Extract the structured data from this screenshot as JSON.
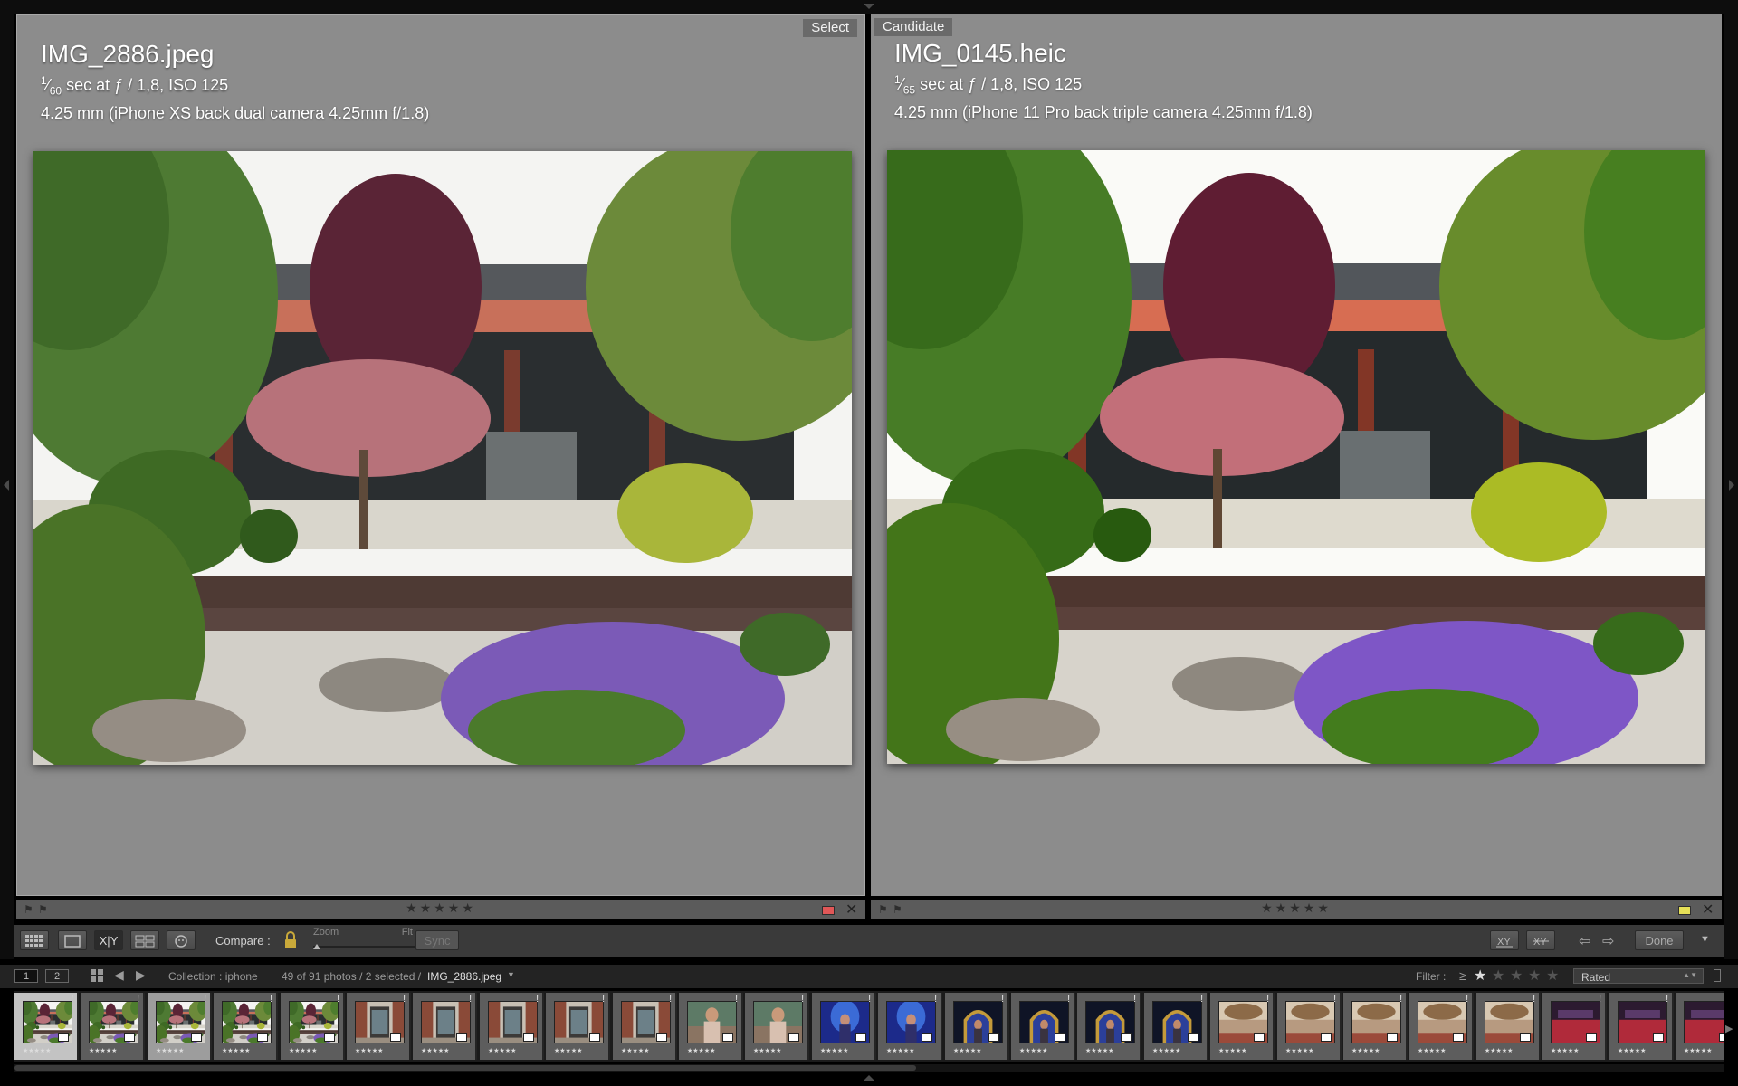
{
  "left_pane": {
    "tag": "Select",
    "filename": "IMG_2886.jpeg",
    "shutter_num": "1",
    "shutter_den": "60",
    "exposure_rest": " sec at ƒ / 1,8, ISO 125",
    "lens": "4.25 mm (iPhone XS back dual camera 4.25mm f/1.8)",
    "rating": "★★★★★",
    "label_color": "#e05757"
  },
  "right_pane": {
    "tag": "Candidate",
    "filename": "IMG_0145.heic",
    "shutter_num": "1",
    "shutter_den": "65",
    "exposure_rest": " sec at ƒ / 1,8, ISO 125",
    "lens": "4.25 mm (iPhone 11 Pro back triple camera 4.25mm f/1.8)",
    "rating": "★★★★★",
    "label_color": "#e6e057"
  },
  "toolbar": {
    "compare_label": "Compare :",
    "zoom_label": "Zoom",
    "fit_label": "Fit",
    "sync_label": "Sync",
    "xy_label": "X|Y",
    "done_label": "Done"
  },
  "filmbar": {
    "screen1": "1",
    "screen2": "2",
    "collection": "Collection : iphone",
    "count": "49 of 91 photos / 2 selected /",
    "current_file": "IMG_2886.jpeg",
    "filter_label": "Filter :",
    "filter_op": "≥",
    "filter_value": "Rated"
  },
  "filmstrip": {
    "cells": [
      {
        "scene": "garden",
        "stars": "★★★★★",
        "state": "active"
      },
      {
        "scene": "garden",
        "stars": "★★★★★",
        "state": "normal"
      },
      {
        "scene": "garden",
        "stars": "★★★★★",
        "state": "sel"
      },
      {
        "scene": "garden",
        "stars": "★★★★★",
        "state": "normal"
      },
      {
        "scene": "garden",
        "stars": "★★★★★",
        "state": "normal"
      },
      {
        "scene": "door",
        "stars": "★★★★★",
        "state": "normal"
      },
      {
        "scene": "door",
        "stars": "★★★★★",
        "state": "normal"
      },
      {
        "scene": "door",
        "stars": "★★★★★",
        "state": "normal"
      },
      {
        "scene": "door",
        "stars": "★★★★★",
        "state": "normal"
      },
      {
        "scene": "door",
        "stars": "★★★★★",
        "state": "normal"
      },
      {
        "scene": "person",
        "stars": "★★★★★",
        "state": "normal"
      },
      {
        "scene": "person",
        "stars": "★★★★★",
        "state": "normal"
      },
      {
        "scene": "blue",
        "stars": "★★★★★",
        "state": "normal"
      },
      {
        "scene": "blue",
        "stars": "★★★★★",
        "state": "normal"
      },
      {
        "scene": "arch",
        "stars": "★★★★★",
        "state": "normal"
      },
      {
        "scene": "arch",
        "stars": "★★★★★",
        "state": "normal"
      },
      {
        "scene": "arch",
        "stars": "★★★★★",
        "state": "normal"
      },
      {
        "scene": "arch",
        "stars": "★★★★★",
        "state": "normal"
      },
      {
        "scene": "hall",
        "stars": "★★★★★",
        "state": "normal"
      },
      {
        "scene": "hall",
        "stars": "★★★★★",
        "state": "normal"
      },
      {
        "scene": "hall",
        "stars": "★★★★★",
        "state": "normal"
      },
      {
        "scene": "hall",
        "stars": "★★★★★",
        "state": "normal"
      },
      {
        "scene": "hall",
        "stars": "★★★★★",
        "state": "normal"
      },
      {
        "scene": "red",
        "stars": "★★★★★",
        "state": "normal"
      },
      {
        "scene": "red",
        "stars": "★★★★★",
        "state": "normal"
      },
      {
        "scene": "red",
        "stars": "★★★★★",
        "state": "normal"
      }
    ]
  }
}
